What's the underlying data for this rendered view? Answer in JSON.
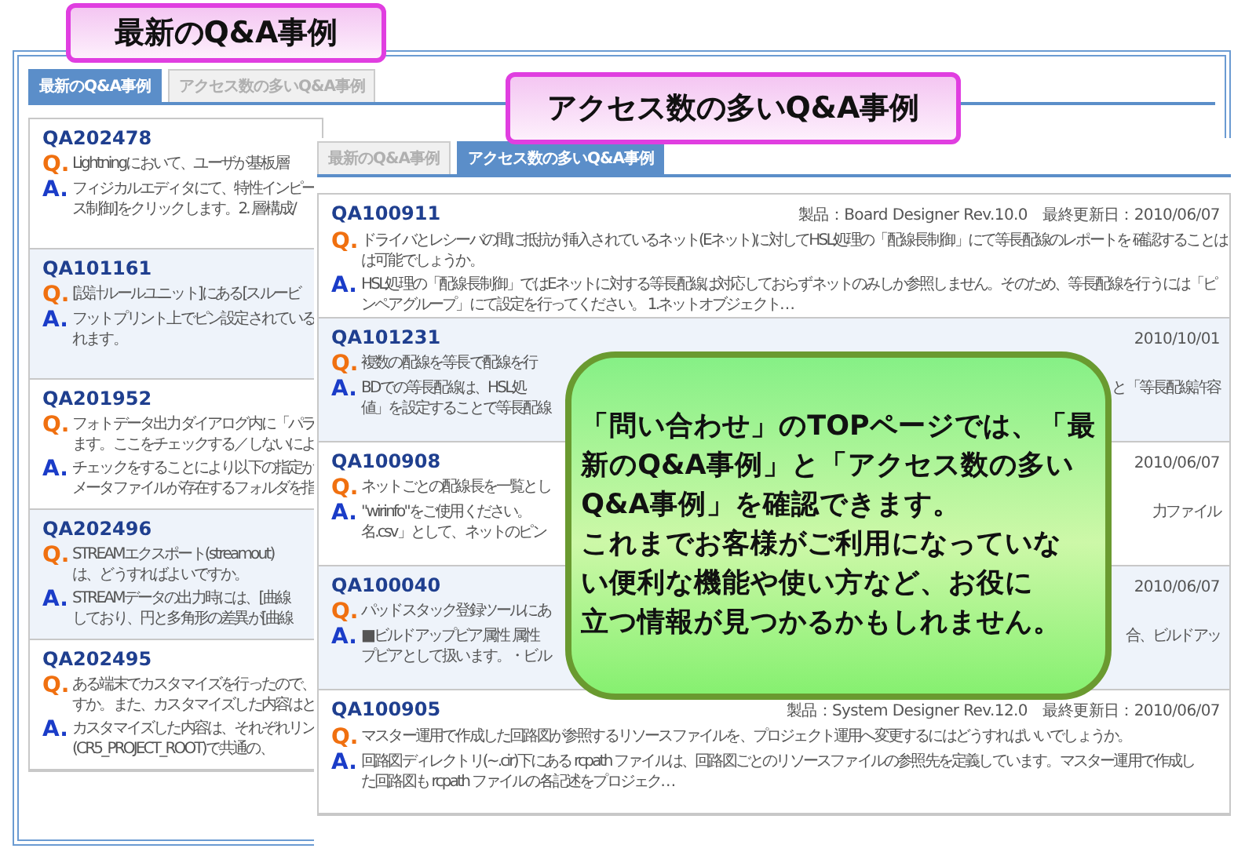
{
  "title_callouts": [
    "最新のQ&A事例",
    "アクセス数の多いQ&A事例"
  ],
  "left_panel": {
    "tabs": [
      {
        "label": "最新のQ&A事例",
        "selected": true
      },
      {
        "label": "アクセス数の多いQ&A事例",
        "selected": false
      }
    ],
    "items": [
      {
        "id": "QA202478",
        "q": {
          "mark": "Q.",
          "lines": [
            {
              "text": "Lightningにおいて、ユーザが基板層"
            }
          ]
        },
        "a": {
          "mark": "A.",
          "lines": [
            {
              "text": "フィジカルエディタにて、特性インピー"
            },
            {
              "text": "ス制御]をクリックします。2. 層構成/"
            }
          ]
        }
      },
      {
        "id": "QA101161",
        "q": {
          "mark": "Q.",
          "lines": [
            {
              "text": "[設計ルールユニット]にある[スルービ"
            }
          ]
        },
        "a": {
          "mark": "A.",
          "lines": [
            {
              "text": "フットプリント上でピン設定されている"
            },
            {
              "text": "れます。"
            }
          ]
        }
      },
      {
        "id": "QA201952",
        "q": {
          "mark": "Q.",
          "lines": [
            {
              "text": "フォトデータ出力ダイアログ内に「パラ"
            },
            {
              "text": "ます。ここをチェックする／しないによ"
            }
          ]
        },
        "a": {
          "mark": "A.",
          "lines": [
            {
              "text": "チェックをすることにより以下の指定が"
            },
            {
              "text": "メータファイルが存在するフォルダを指"
            }
          ]
        }
      },
      {
        "id": "QA202496",
        "q": {
          "mark": "Q.",
          "lines": [
            {
              "text": "STREAMエクスポート(streamout)"
            },
            {
              "text": "は、どうすればよいですか。"
            }
          ]
        },
        "a": {
          "mark": "A.",
          "lines": [
            {
              "text": "STREAMデータの出力時には、[曲線"
            },
            {
              "text": "しており、円と多角形の差異が[曲線"
            }
          ]
        }
      },
      {
        "id": "QA202495",
        "q": {
          "mark": "Q.",
          "lines": [
            {
              "text": "ある端末でカスタマイズを行ったので、"
            },
            {
              "text": "すか。また、カスタマイズした内容はと"
            }
          ]
        },
        "a": {
          "mark": "A.",
          "lines": [
            {
              "text": "カスタマイズした内容は、それぞれリン"
            },
            {
              "text": "(CR5_PROJECT_ROOT)で共通の、"
            }
          ]
        }
      }
    ]
  },
  "right_panel": {
    "tabs": [
      {
        "label": "最新のQ&A事例",
        "selected": false
      },
      {
        "label": "アクセス数の多いQ&A事例",
        "selected": true
      }
    ],
    "items": [
      {
        "id": "QA100911",
        "meta": "製品：Board Designer Rev.10.0　最終更新日：2010/06/07",
        "q": {
          "mark": "Q.",
          "lines": [
            {
              "text": "ドライバとレシーバの間に抵抗が挿入されているネット(Eネット)に対してHSL処理の「配線長制御」にて等長配線のレポートを 確認することは"
            },
            {
              "text": "は可能でしょうか。"
            }
          ]
        },
        "a": {
          "mark": "A.",
          "lines": [
            {
              "text": "HSL処理の「配線長制御」ではEネットに対する等長配線は対応しておらずネットのみしか参照しません。そのため、等長配線を行うには「ピ"
            },
            {
              "text": "ンペアグループ」にて設定を行ってください。 1.ネットオブジェクト…"
            }
          ]
        }
      },
      {
        "id": "QA101231",
        "meta": "2010/10/01",
        "q": {
          "mark": "Q.",
          "lines": [
            {
              "text": "複数の配線を等長で配線を行"
            }
          ]
        },
        "a": {
          "mark": "A.",
          "lines": [
            {
              "text": "BDでの等長配線は、HSL処",
              "tail": "と「等長配線許容"
            },
            {
              "text": "値」を設定することで等長配線"
            }
          ]
        }
      },
      {
        "id": "QA100908",
        "meta": "2010/06/07",
        "q": {
          "mark": "Q.",
          "lines": [
            {
              "text": "ネットごとの配線長を一覧とし"
            }
          ]
        },
        "a": {
          "mark": "A.",
          "lines": [
            {
              "text": "\"wirinfo\"をご使用ください。",
              "tail": "力ファイル"
            },
            {
              "text": "名.csv」として、ネットのピン"
            }
          ]
        }
      },
      {
        "id": "QA100040",
        "meta": "2010/06/07",
        "q": {
          "mark": "Q.",
          "lines": [
            {
              "text": "パッドスタック登録ツールにあ"
            }
          ]
        },
        "a": {
          "mark": "A.",
          "lines": [
            {
              "text": "■ビルドアップビア属性 属性",
              "tail": "合、ビルドアッ"
            },
            {
              "text": "プビアとして扱います。・ビル"
            }
          ]
        }
      },
      {
        "id": "QA100905",
        "meta": "製品：System Designer Rev.12.0　最終更新日：2010/06/07",
        "q": {
          "mark": "Q.",
          "lines": [
            {
              "text": "マスター運用で作成した回路図が参照するリソースファイルを、プロジェクト運用へ変更するにはどうすればいいでしょうか。"
            }
          ]
        },
        "a": {
          "mark": "A.",
          "lines": [
            {
              "text": "回路図ディレクトリ(~.cir)下にある rcpath ファイルは、回路図ごとのリソースファイルの参照先を定義しています。マスター運用で作成し"
            },
            {
              "text": "た回路図も rcpath ファイルの各記述をプロジェク…"
            }
          ]
        }
      }
    ]
  },
  "info_callout": {
    "lines": [
      "「問い合わせ」のTOPページでは、「最",
      "新のQ&A事例」と「アクセス数の多い",
      "Q&A事例」を確認できます。",
      "これまでお客様がご利用になっていな",
      "い便利な機能や使い方など、お役に",
      "立つ情報が見つかるかもしれません。"
    ]
  }
}
